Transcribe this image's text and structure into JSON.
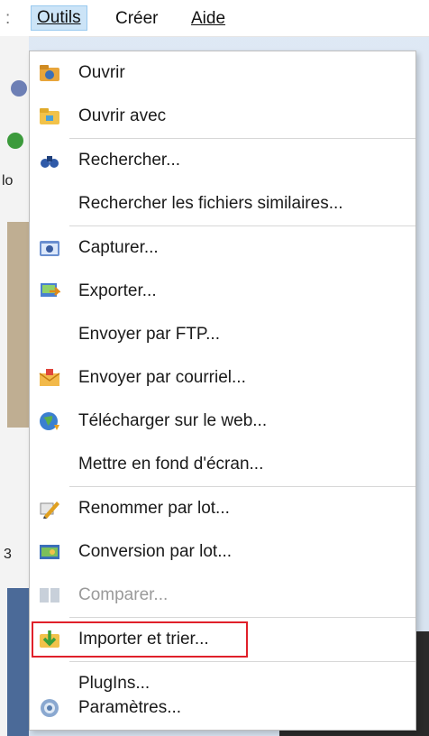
{
  "menubar": {
    "items": [
      {
        "label": "Outils",
        "active": true
      },
      {
        "label": "Créer",
        "active": false
      },
      {
        "label": "Aide",
        "active": false
      }
    ],
    "left_fragment": ":"
  },
  "background": {
    "fragments": [
      "lo",
      "3"
    ]
  },
  "menu": {
    "items": [
      {
        "label": "Ouvrir",
        "icon": "open-folder-icon"
      },
      {
        "label": "Ouvrir avec",
        "icon": "open-with-folder-icon"
      },
      {
        "label": "Rechercher...",
        "icon": "binoculars-icon"
      },
      {
        "label": "Rechercher les fichiers similaires...",
        "icon": ""
      },
      {
        "label": "Capturer...",
        "icon": "camera-icon"
      },
      {
        "label": "Exporter...",
        "icon": "export-icon"
      },
      {
        "label": "Envoyer par FTP...",
        "icon": ""
      },
      {
        "label": "Envoyer par courriel...",
        "icon": "envelope-icon"
      },
      {
        "label": "Télécharger sur le web...",
        "icon": "globe-icon"
      },
      {
        "label": "Mettre en fond d'écran...",
        "icon": ""
      },
      {
        "label": "Renommer par lot...",
        "icon": "pencil-icon"
      },
      {
        "label": "Conversion par lot...",
        "icon": "batch-convert-icon"
      },
      {
        "label": "Comparer...",
        "icon": "compare-icon",
        "disabled": true
      },
      {
        "label": "Importer et trier...",
        "icon": "import-sort-icon",
        "highlighted": true
      },
      {
        "label": "PlugIns...",
        "icon": ""
      },
      {
        "label": "Paramètres...",
        "icon": "gear-icon"
      }
    ]
  },
  "colors": {
    "highlight_border": "#e0202a",
    "menubar_active_bg": "#cce4f7",
    "disabled_text": "#9a9a9a"
  }
}
